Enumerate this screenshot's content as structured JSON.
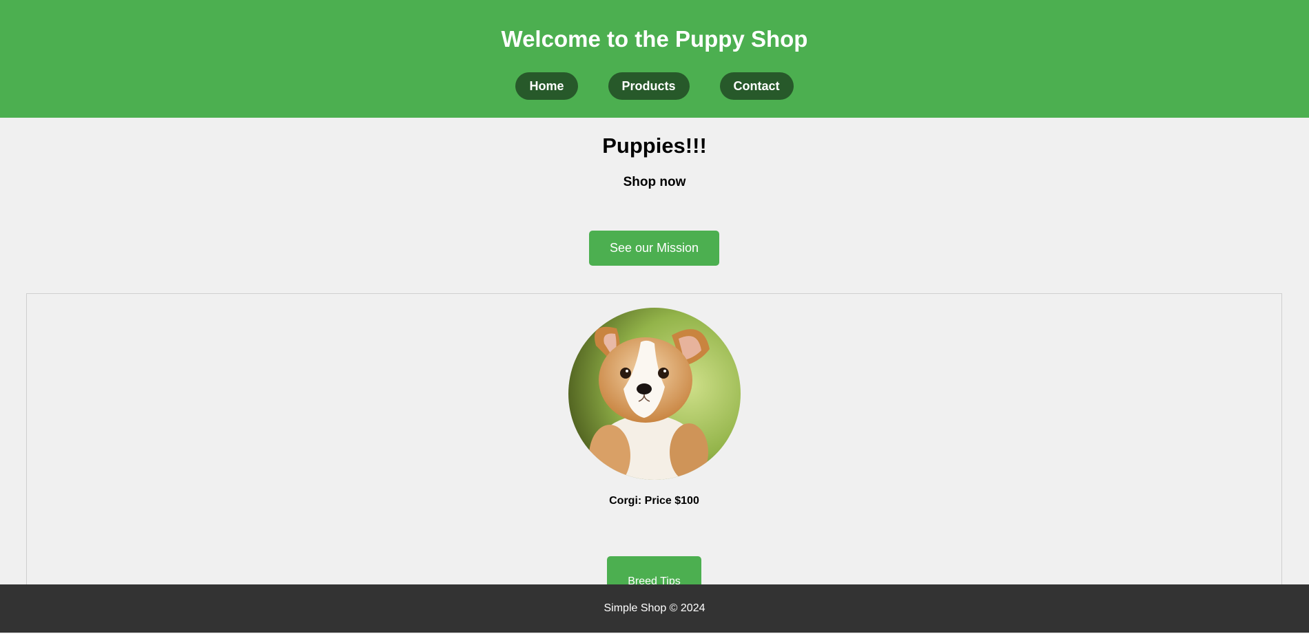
{
  "header": {
    "title": "Welcome to the Puppy Shop",
    "nav": [
      {
        "label": "Home"
      },
      {
        "label": "Products"
      },
      {
        "label": "Contact"
      }
    ]
  },
  "hero": {
    "title": "Puppies!!!",
    "subtitle": "Shop now",
    "mission_button": "See our Mission"
  },
  "product": {
    "image_icon": "corgi-puppy-photo",
    "label": "Corgi: Price $100",
    "tips_button": "Breed Tips"
  },
  "footer": {
    "text": "Simple Shop © 2024"
  },
  "colors": {
    "brand_green": "#4caf50",
    "nav_dark_green": "#27592a",
    "footer_bg": "#333333",
    "page_bg": "#f0f0f0"
  }
}
